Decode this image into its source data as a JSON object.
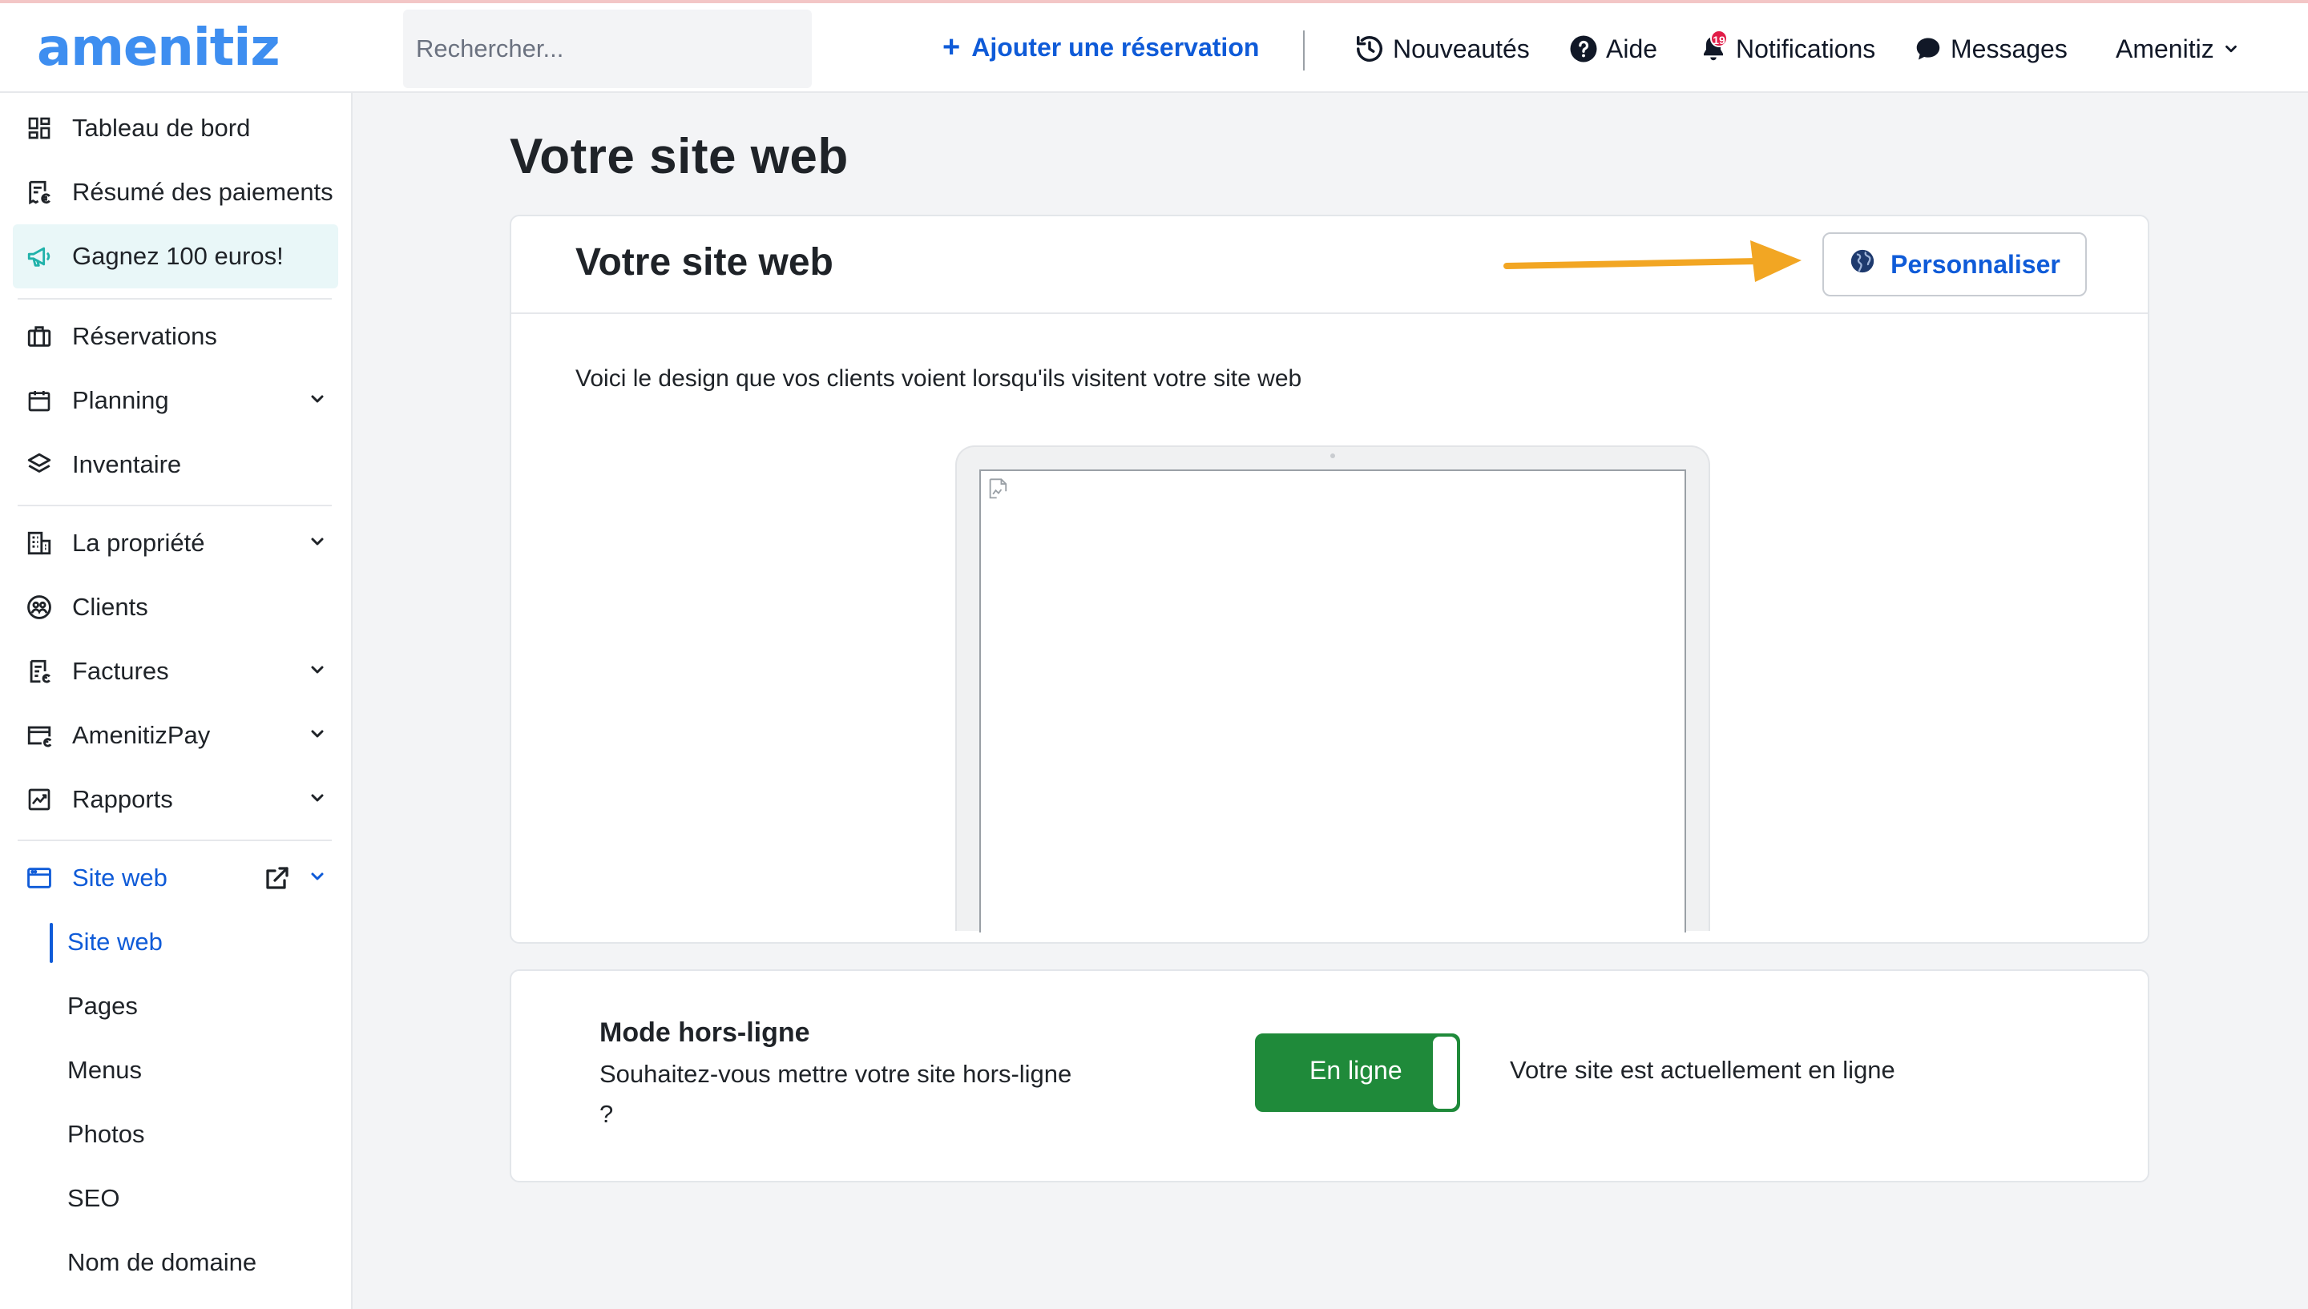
{
  "app": {
    "logo_text": "amenitiz"
  },
  "search": {
    "placeholder": "Rechercher..."
  },
  "topbar": {
    "add_reservation": "Ajouter une réservation",
    "nouveautes": "Nouveautés",
    "aide": "Aide",
    "notifications": "Notifications",
    "notifications_count": "19",
    "messages": "Messages",
    "account": "Amenitiz"
  },
  "sidebar": {
    "items": [
      {
        "label": "Tableau de bord"
      },
      {
        "label": "Résumé des paiements"
      },
      {
        "label": "Gagnez 100 euros!"
      },
      {
        "label": "Réservations"
      },
      {
        "label": "Planning"
      },
      {
        "label": "Inventaire"
      },
      {
        "label": "La propriété"
      },
      {
        "label": "Clients"
      },
      {
        "label": "Factures"
      },
      {
        "label": "AmenitizPay"
      },
      {
        "label": "Rapports"
      },
      {
        "label": "Site web"
      }
    ],
    "sub_items": [
      {
        "label": "Site web"
      },
      {
        "label": "Pages"
      },
      {
        "label": "Menus"
      },
      {
        "label": "Photos"
      },
      {
        "label": "SEO"
      },
      {
        "label": "Nom de domaine"
      }
    ]
  },
  "main": {
    "page_title": "Votre site web",
    "website_card": {
      "title": "Votre site web",
      "customize_button": "Personnaliser",
      "description": "Voici le design que vos clients voient lorsqu'ils visitent votre site web"
    },
    "offline_card": {
      "title": "Mode hors-ligne",
      "question": "Souhaitez-vous mettre votre site hors-ligne ?",
      "toggle_label": "En ligne",
      "status": "Votre site est actuellement en ligne"
    }
  },
  "colors": {
    "accent": "#0f5bd8",
    "logo": "#3e8ef0",
    "online": "#1f8a3a",
    "arrow": "#f2a623"
  }
}
